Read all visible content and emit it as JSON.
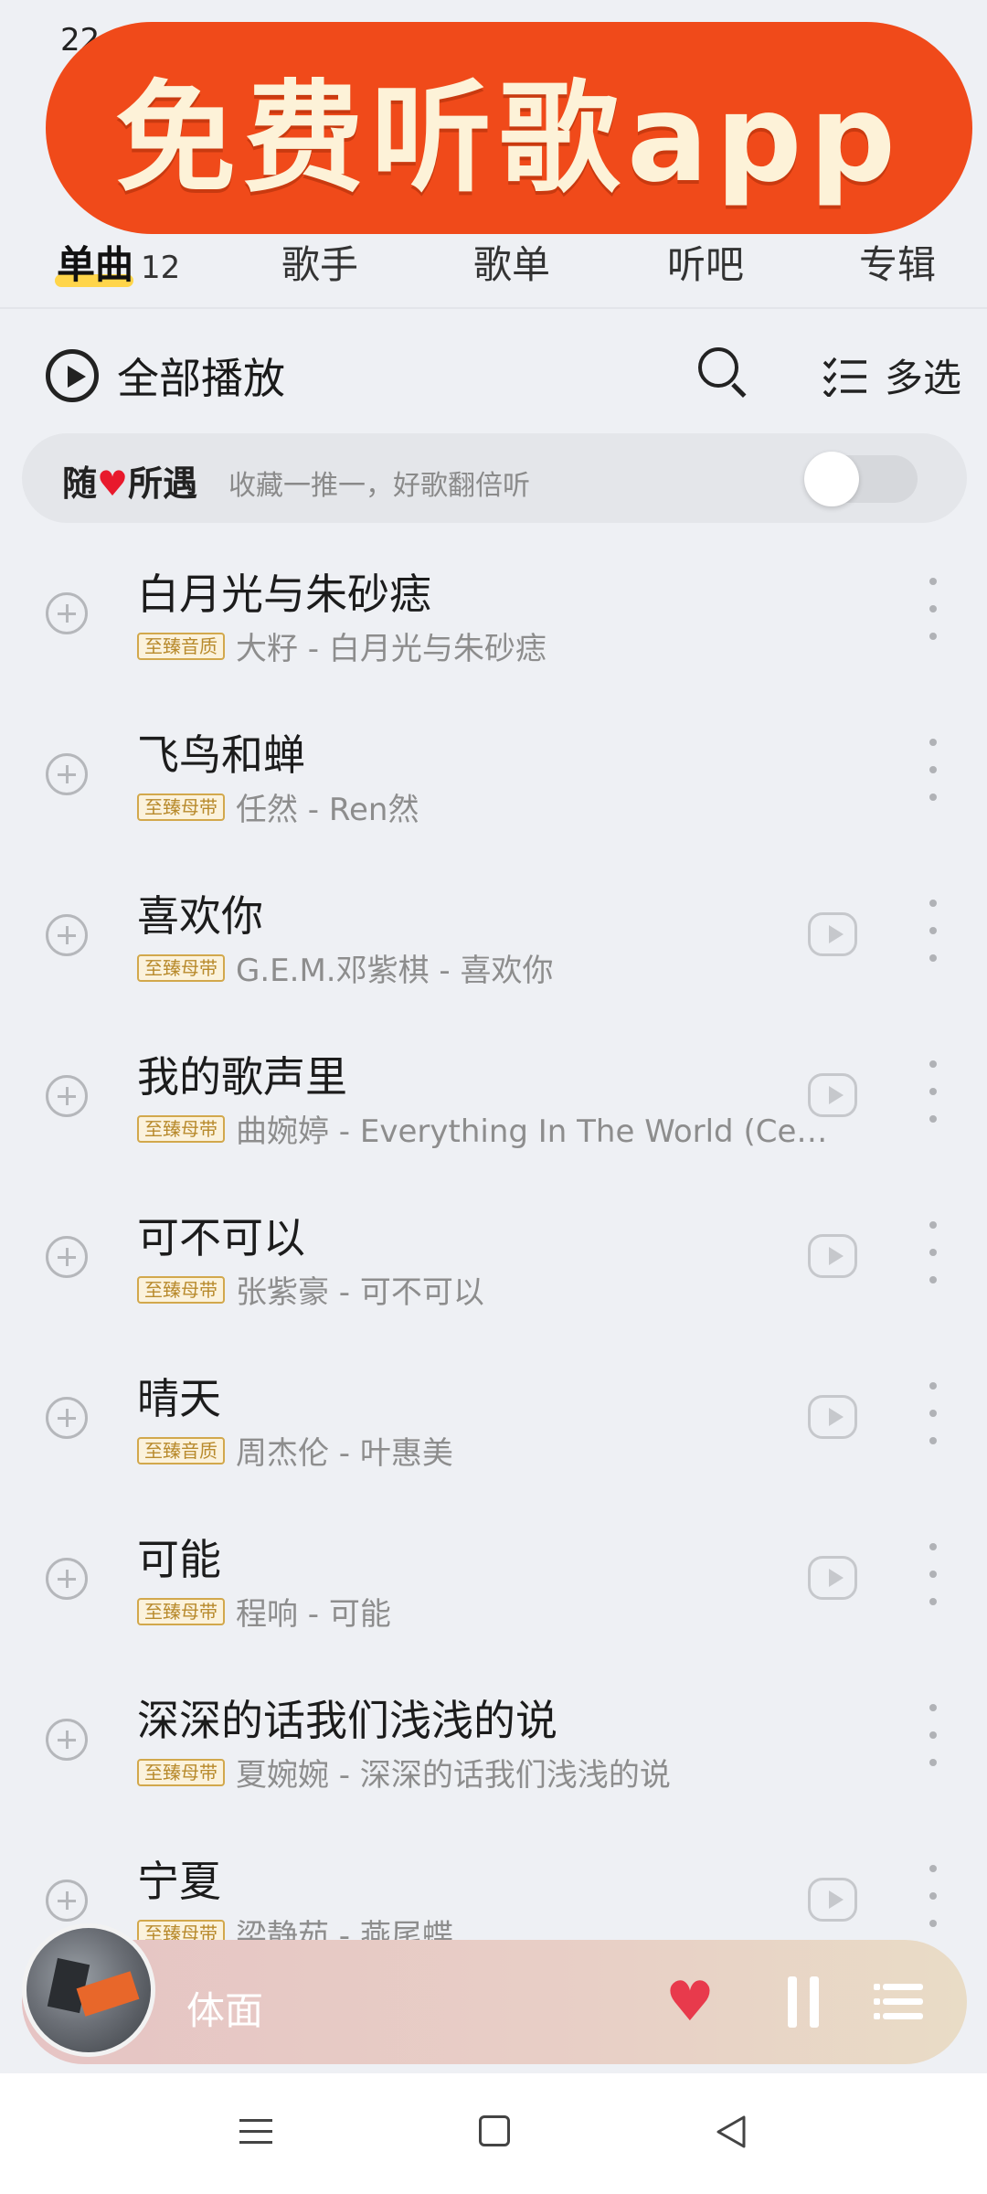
{
  "status_bar": {
    "time": "22"
  },
  "banner": {
    "text": "免费听歌app"
  },
  "tabs": [
    {
      "label": "单曲",
      "count": "12",
      "active": true
    },
    {
      "label": "歌手"
    },
    {
      "label": "歌单"
    },
    {
      "label": "听吧"
    },
    {
      "label": "专辑"
    }
  ],
  "toolbar": {
    "play_all_label": "全部播放",
    "multi_select_label": "多选"
  },
  "serendipity": {
    "title_part1": "随",
    "title_heart": "♥",
    "title_part2": "所遇",
    "subtitle": "收藏一推一，好歌翻倍听",
    "toggle_on": false
  },
  "songs": [
    {
      "title": "白月光与朱砂痣",
      "badge": "至臻音质",
      "artist_line": "大籽 - 白月光与朱砂痣",
      "has_mv": false
    },
    {
      "title": "飞鸟和蝉",
      "badge": "至臻母带",
      "artist_line": "任然 - Ren然",
      "has_mv": false
    },
    {
      "title": "喜欢你",
      "badge": "至臻母带",
      "artist_line": "G.E.M.邓紫棋 - 喜欢你",
      "has_mv": true
    },
    {
      "title": "我的歌声里",
      "badge": "至臻母带",
      "artist_line": "曲婉婷 - Everything In The World (Ce…",
      "has_mv": true
    },
    {
      "title": "可不可以",
      "badge": "至臻母带",
      "artist_line": "张紫豪 - 可不可以",
      "has_mv": true
    },
    {
      "title": "晴天",
      "badge": "至臻音质",
      "artist_line": "周杰伦 - 叶惠美",
      "has_mv": true
    },
    {
      "title": "可能",
      "badge": "至臻母带",
      "artist_line": "程响 - 可能",
      "has_mv": true
    },
    {
      "title": "深深的话我们浅浅的说",
      "badge": "至臻母带",
      "artist_line": "夏婉婉 - 深深的话我们浅浅的说",
      "has_mv": false
    },
    {
      "title": "宁夏",
      "badge": "至臻母带",
      "artist_line": "梁静茹 - 燕尾蝶",
      "has_mv": true
    }
  ],
  "mini_player": {
    "title": "体面",
    "heart_icon": "heart-icon"
  },
  "colors": {
    "banner_bg": "#f04a1a",
    "banner_text": "#fdf2d8",
    "heart": "#e83a4c",
    "badge_gold": "#b88a2c"
  }
}
